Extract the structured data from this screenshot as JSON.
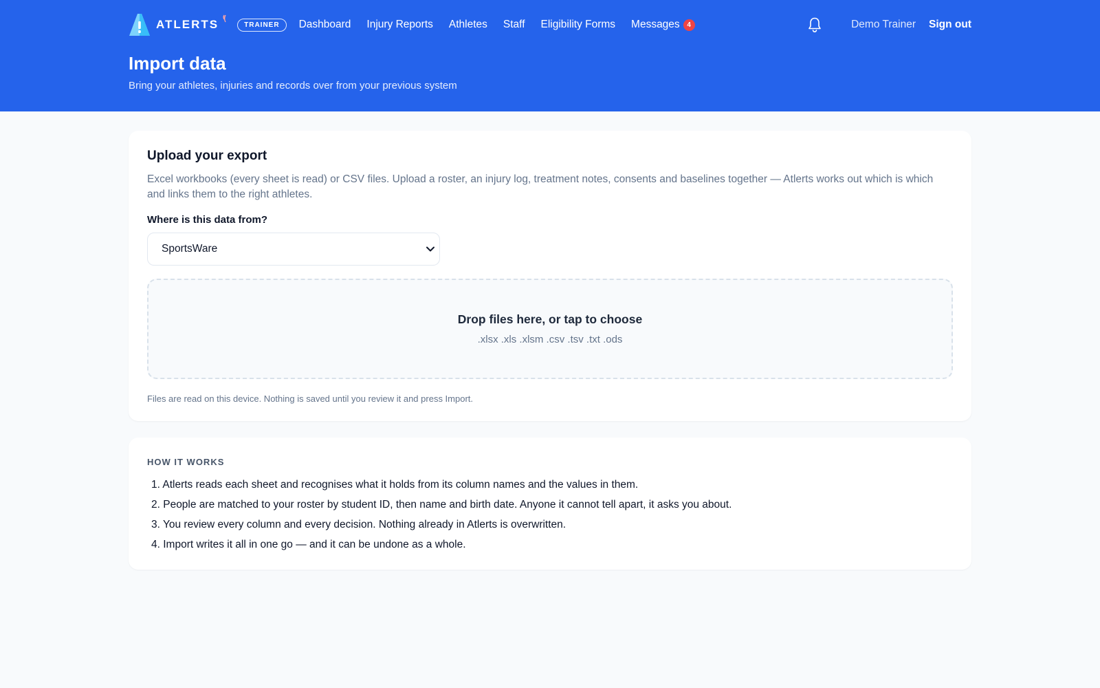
{
  "app": {
    "name": "ATLERTS",
    "role_badge": "TRAINER"
  },
  "nav": [
    {
      "label": "Dashboard"
    },
    {
      "label": "Injury Reports"
    },
    {
      "label": "Athletes"
    },
    {
      "label": "Staff"
    },
    {
      "label": "Eligibility Forms"
    },
    {
      "label": "Messages",
      "badge": "4"
    }
  ],
  "user": {
    "name": "Demo Trainer",
    "signout_label": "Sign out"
  },
  "page": {
    "title": "Import data",
    "subtitle": "Bring your athletes, injuries and records over from your previous system"
  },
  "upload": {
    "title": "Upload your export",
    "description": "Excel workbooks (every sheet is read) or CSV files. Upload a roster, an injury log, treatment notes, consents and baselines together — Atlerts works out which is which and links them to the right athletes.",
    "source_label": "Where is this data from?",
    "source_selected": "SportsWare",
    "dropzone_title": "Drop files here, or tap to choose",
    "dropzone_types": ".xlsx .xls .xlsm .csv .tsv .txt .ods",
    "note": "Files are read on this device. Nothing is saved until you review it and press Import."
  },
  "how": {
    "title": "HOW IT WORKS",
    "steps": [
      {
        "text": "1. Atlerts reads each sheet and recognises what it holds from its column names and the values in them."
      },
      {
        "text": "2. People are matched to your roster by student ID, then name and birth date. Anyone it cannot tell apart, it asks you about."
      },
      {
        "text": "3. You review every column and every decision. Nothing already in Atlerts is overwritten."
      },
      {
        "text": "4. Import writes it all in one go — and it can be undone as a whole."
      }
    ]
  },
  "icons": {
    "logo": "atlerts-logo-icon",
    "bell": "bell-icon",
    "chevron": "chevron-down-icon"
  },
  "colors": {
    "header_bg": "#2563eb",
    "badge_red": "#ef4444",
    "page_bg": "#f8fafc"
  }
}
